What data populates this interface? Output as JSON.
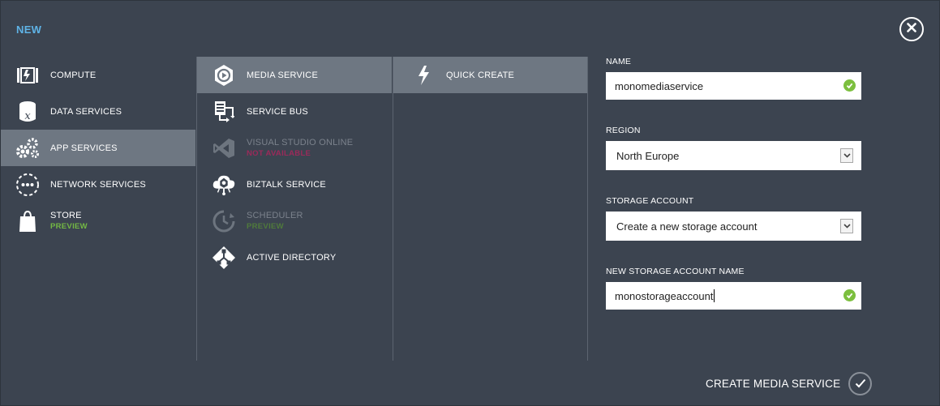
{
  "dialog": {
    "title": "NEW",
    "create_label": "CREATE MEDIA SERVICE"
  },
  "categories": [
    {
      "label": "COMPUTE",
      "icon": "compute-icon",
      "selected": false
    },
    {
      "label": "DATA SERVICES",
      "icon": "data-services-icon",
      "selected": false
    },
    {
      "label": "APP SERVICES",
      "icon": "gears-icon",
      "selected": true
    },
    {
      "label": "NETWORK SERVICES",
      "icon": "network-icon",
      "selected": false
    },
    {
      "label": "STORE",
      "sub": "PREVIEW",
      "icon": "shopping-bag-icon",
      "selected": false
    }
  ],
  "services": [
    {
      "label": "MEDIA SERVICE",
      "icon": "media-play-icon",
      "selected": true
    },
    {
      "label": "SERVICE BUS",
      "icon": "service-bus-icon",
      "selected": false
    },
    {
      "label": "VISUAL STUDIO ONLINE",
      "sub": "NOT AVAILABLE",
      "icon": "visual-studio-icon",
      "disabled": true
    },
    {
      "label": "BIZTALK SERVICE",
      "icon": "biztalk-cloud-icon",
      "selected": false
    },
    {
      "label": "SCHEDULER",
      "sub": "PREVIEW",
      "icon": "scheduler-clock-icon",
      "disabled": true
    },
    {
      "label": "ACTIVE DIRECTORY",
      "icon": "active-directory-icon",
      "selected": false
    }
  ],
  "methods": [
    {
      "label": "QUICK CREATE",
      "icon": "lightning-icon",
      "selected": true
    }
  ],
  "form": {
    "name_label": "NAME",
    "name_value": "monomediaservice",
    "region_label": "REGION",
    "region_value": "North Europe",
    "storage_label": "STORAGE ACCOUNT",
    "storage_value": "Create a new storage account",
    "new_storage_label": "NEW STORAGE ACCOUNT NAME",
    "new_storage_value": "monostorageaccount"
  },
  "colors": {
    "background": "#3c4450",
    "selected": "#6e7782",
    "title": "#5fb3e6",
    "preview_green": "#73b844",
    "not_available": "#9b2a5a",
    "valid_check": "#7cbf3e"
  }
}
